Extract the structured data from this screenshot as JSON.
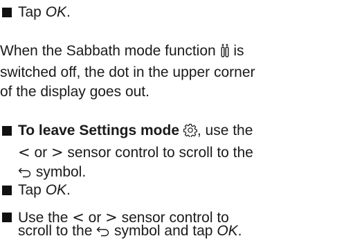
{
  "steps": [
    {
      "action": "Tap ",
      "key": "OK",
      "end": "."
    }
  ],
  "note": {
    "line1_pre": "When the Sabbath mode function ",
    "line1_post": " is",
    "sabbath_icon": "sabbath-mode-icon",
    "line2": "switched off, the dot in the upper corner",
    "line3": "of the display goes out."
  },
  "leave": {
    "heading": "To leave Settings mode",
    "settings_icon": "gear-icon",
    "line1_post": ", use the",
    "line2_lt": "<",
    "line2_mid": " or ",
    "line2_gt": ">",
    "line2_post": " sensor control to scroll to the",
    "return_icon": "return-arrow-icon",
    "line3_post": " symbol."
  },
  "step2": {
    "action": "Tap ",
    "key": "OK",
    "end": "."
  },
  "step3": {
    "line1_pre": "Use the ",
    "lt": "<",
    "mid": " or ",
    "gt": ">",
    "line1_post": " sensor control to",
    "line2_pre": "scroll to the ",
    "return_icon": "return-arrow-icon",
    "line2_post": " symbol and tap ",
    "key": "OK",
    "end": "."
  }
}
